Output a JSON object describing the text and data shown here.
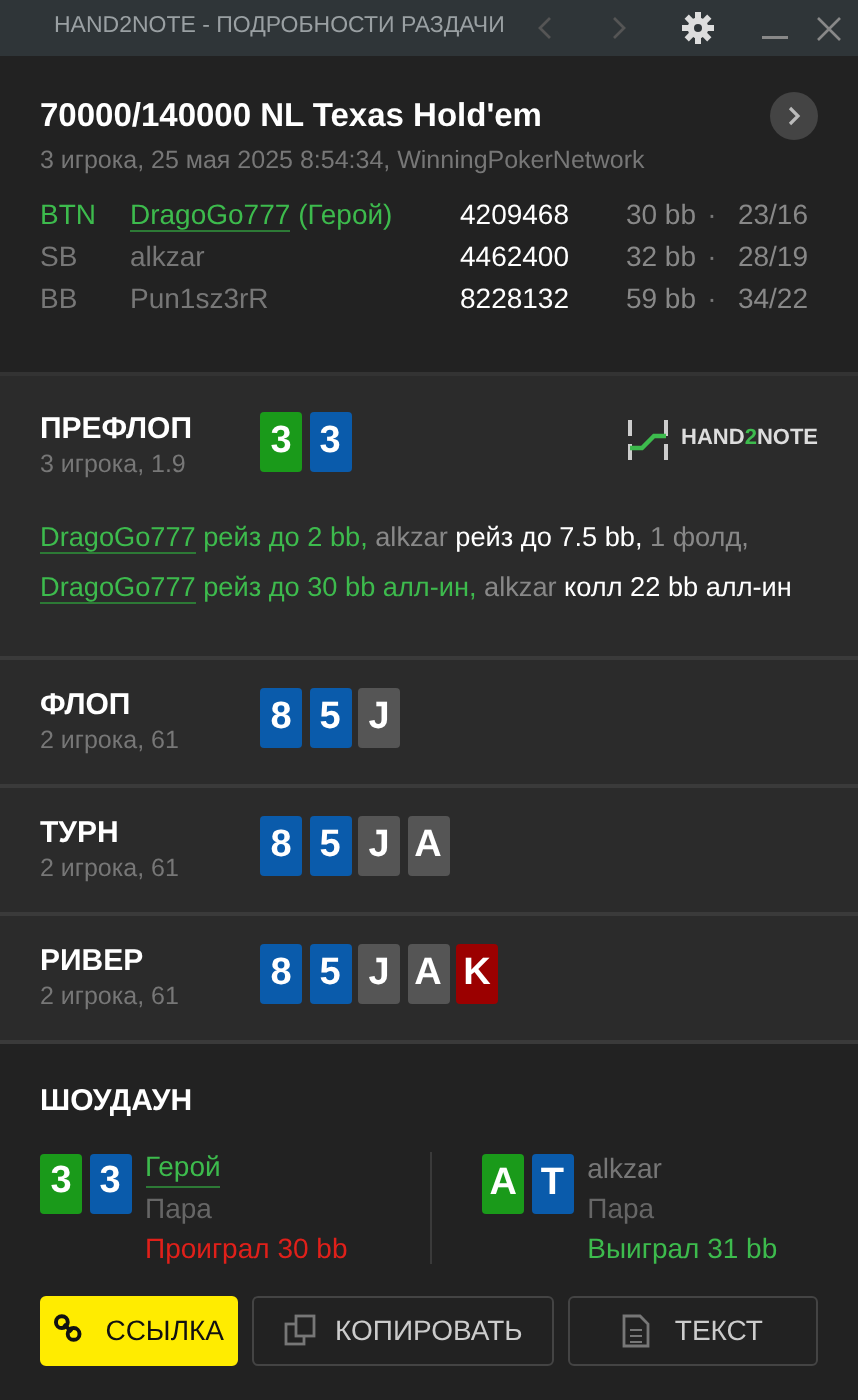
{
  "window": {
    "title": "HAND2NOTE - ПОДРОБНОСТИ РАЗДАЧИ",
    "back_disabled": true,
    "forward_disabled": true
  },
  "header": {
    "title": "70000/140000 NL Texas Hold'em",
    "subtitle": "3 игрока, 25 мая 2025 8:54:34, WinningPokerNetwork"
  },
  "players": [
    {
      "position": "BTN",
      "name": "DragoGo777",
      "hero": true,
      "hero_tag": "(Герой)",
      "id": "4209468",
      "stack": "30 bb",
      "separator": "·",
      "stats": "23/16"
    },
    {
      "position": "SB",
      "name": "alkzar",
      "hero": false,
      "id": "4462400",
      "stack": "32 bb",
      "separator": "·",
      "stats": "28/19"
    },
    {
      "position": "BB",
      "name": "Pun1sz3rR",
      "hero": false,
      "id": "8228132",
      "stack": "59 bb",
      "separator": "·",
      "stats": "34/22"
    }
  ],
  "logo": {
    "parts": [
      "HAND",
      "2",
      "NOTE"
    ]
  },
  "streets": [
    {
      "name": "ПРЕФЛОП",
      "info": "3 игрока, 1.9",
      "cards": [
        {
          "rank": "3",
          "color": "#1a9a1a"
        },
        {
          "rank": "3",
          "color": "#0a5bab"
        }
      ],
      "actions": [
        {
          "kind": "hero-name",
          "text": "DragoGo777"
        },
        {
          "kind": "hero-action",
          "text": " рейз до 2 bb, "
        },
        {
          "kind": "villain-name",
          "text": "alkzar"
        },
        {
          "kind": "villain-action",
          "text": " рейз до 7.5 bb, "
        },
        {
          "kind": "neutral",
          "text": "1 фолд, "
        },
        {
          "kind": "hero-name",
          "text": "DragoGo777"
        },
        {
          "kind": "hero-action",
          "text": " рейз до 30 bb алл-ин, "
        },
        {
          "kind": "villain-name",
          "text": "alkzar"
        },
        {
          "kind": "villain-action",
          "text": " колл 22 bb алл-ин"
        }
      ]
    },
    {
      "name": "ФЛОП",
      "info": "2 игрока, 61",
      "cards": [
        {
          "rank": "8",
          "color": "#0a5bab"
        },
        {
          "rank": "5",
          "color": "#0a5bab"
        },
        {
          "rank": "J",
          "color": "#555555"
        }
      ]
    },
    {
      "name": "ТУРН",
      "info": "2 игрока, 61",
      "cards": [
        {
          "rank": "8",
          "color": "#0a5bab"
        },
        {
          "rank": "5",
          "color": "#0a5bab"
        },
        {
          "rank": "J",
          "color": "#555555"
        },
        {
          "rank": "A",
          "color": "#555555"
        }
      ]
    },
    {
      "name": "РИВЕР",
      "info": "2 игрока, 61",
      "cards": [
        {
          "rank": "8",
          "color": "#0a5bab"
        },
        {
          "rank": "5",
          "color": "#0a5bab"
        },
        {
          "rank": "J",
          "color": "#555555"
        },
        {
          "rank": "A",
          "color": "#555555"
        },
        {
          "rank": "K",
          "color": "#9b0000"
        }
      ]
    }
  ],
  "showdown": {
    "title": "ШОУДАУН",
    "hands": [
      {
        "cards": [
          {
            "rank": "3",
            "color": "#1a9a1a"
          },
          {
            "rank": "3",
            "color": "#0a5bab"
          }
        ],
        "player": "Герой",
        "hero": true,
        "combo": "Пара",
        "result": "Проиграл 30 bb",
        "won": false
      },
      {
        "cards": [
          {
            "rank": "A",
            "color": "#1a9a1a"
          },
          {
            "rank": "T",
            "color": "#0a5bab"
          }
        ],
        "player": "alkzar",
        "hero": false,
        "combo": "Пара",
        "result": "Выиграл 31 bb",
        "won": true
      }
    ]
  },
  "buttons": [
    {
      "kind": "link",
      "label": "ССЫЛКА"
    },
    {
      "kind": "copy",
      "label": "КОПИРОВАТЬ"
    },
    {
      "kind": "text",
      "label": "ТЕКСТ"
    }
  ]
}
